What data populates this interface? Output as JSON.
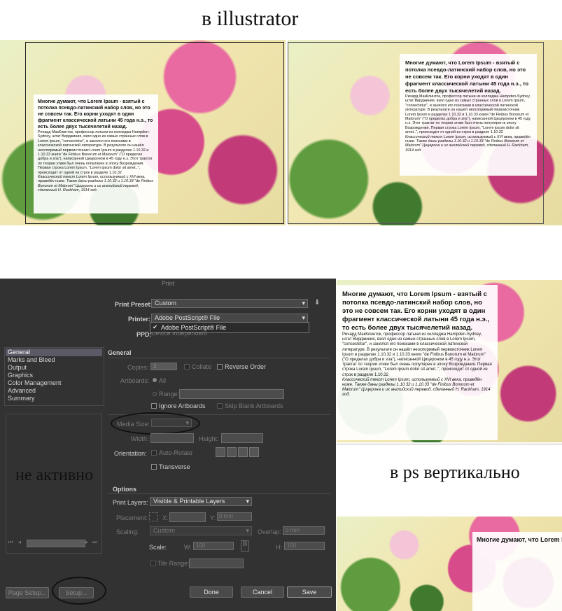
{
  "captions": {
    "illustrator": "в illustrator",
    "ps_vertical": "в ps вертикально",
    "inactive": "не активно"
  },
  "text_block": {
    "heading": "Многие думают, что Lorem Ipsum - взятый с потолка псевдо-латинский набор слов, но это не совсем так. Его корни уходят в один фрагмент классической латыни 45 года н.э., то есть более двух тысячелетий назад.",
    "body": "Ричард МакКлинток, профессор латыни из колледжа Hampden-Sydney, штат Вирджиния, взял одно из самых странных слов в Lorem Ipsum, \"consectetur\", и занялся его поисками в классической латинской литературе. В результате он нашёл неоспоримый первоисточник Lorem Ipsum в разделах 1.10.32 и 1.10.33 книги \"de Finibus Bonorum et Malorum\" (\"О пределах добра и зла\"), написанной Цицероном в 45 году н.э. Этот трактат по теории этики был очень популярен в эпоху Возрождения. Первая строка Lorem Ipsum, \"Lorem ipsum dolor sit amet..\", происходит от одной из строк в разделе 1.10.32",
    "italic": "Классический текст Lorem Ipsum, используемый с XVI века, приведён ниже. Также даны разделы 1.10.32 и 1.10.33 \"de Finibus Bonorum et Malorum\" Цицерона и их английский перевод, сделанный H. Rackham, 1914 год."
  },
  "dialog": {
    "title": "Print",
    "print_preset_label": "Print Preset:",
    "print_preset_value": "Custom",
    "printer_label": "Printer:",
    "printer_value": "Adobe PostScript® File",
    "printer_option": "Adobe PostScript® File",
    "ppd_label": "PPD:",
    "ppd_value": "Device Independent",
    "nav": [
      "General",
      "Marks and Bleed",
      "Output",
      "Graphics",
      "Color Management",
      "Advanced",
      "Summary"
    ],
    "nav_selected": "General",
    "general_title": "General",
    "copies_label": "Copies:",
    "copies_value": "1",
    "collate": "Collate",
    "reverse_order": "Reverse Order",
    "artboards_label": "Artboards:",
    "all": "All",
    "range": "Range:",
    "ignore_artboards": "Ignore Artboards",
    "skip_blank": "Skip Blank Artboards",
    "media_size_label": "Media Size:",
    "width_label": "Width:",
    "height_label": "Height:",
    "orientation_label": "Orientation:",
    "auto_rotate": "Auto-Rotate",
    "transverse": "Transverse",
    "options_title": "Options",
    "print_layers_label": "Print Layers:",
    "print_layers_value": "Visible & Printable Layers",
    "placement_label": "Placement:",
    "x_label": "X:",
    "y_label": "Y:",
    "y_value": "0 mm",
    "scaling_label": "Scaling:",
    "scaling_value": "Custom",
    "overlap_label": "Overlap:",
    "overlap_value": "0 mm",
    "scale_label": "Scale:",
    "w_label": "W:",
    "w_value": "100",
    "h_label": "H:",
    "h_value": "100",
    "tile_range": "Tile Range:",
    "page_setup": "Page Setup...",
    "setup": "Setup...",
    "done": "Done",
    "cancel": "Cancel",
    "save": "Save"
  },
  "colors": {
    "dialog_bg": "#323232",
    "nav_selected_bg": "#5a5a66",
    "annotation_ink": "#111111"
  }
}
